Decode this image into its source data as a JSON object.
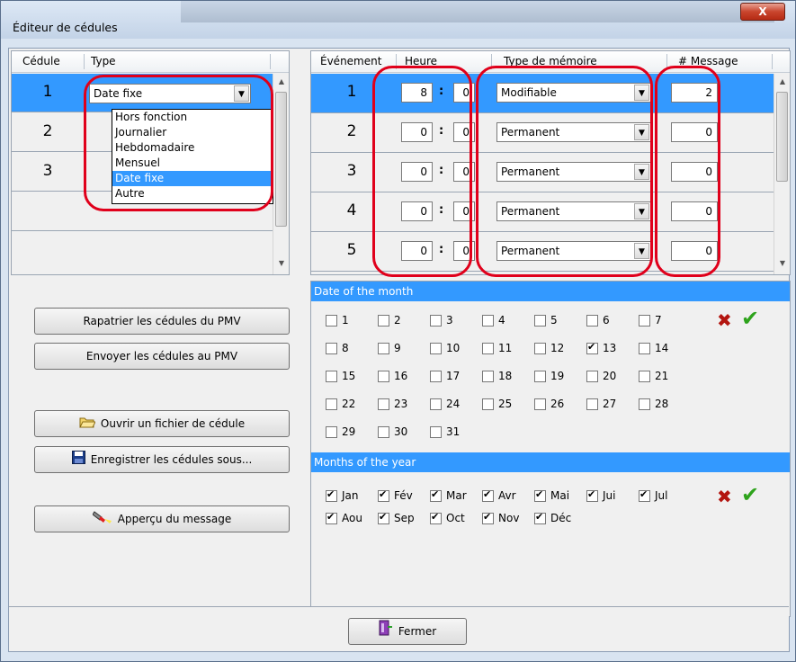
{
  "window": {
    "title": "Éditeur de cédules",
    "close": "X"
  },
  "left_grid": {
    "headers": [
      "Cédule",
      "Type"
    ],
    "rows": [
      {
        "num": "1",
        "type": "Date fixe"
      },
      {
        "num": "2",
        "type": ""
      },
      {
        "num": "3",
        "type": ""
      }
    ],
    "dropdown_options": [
      "Hors fonction",
      "Journalier",
      "Hebdomadaire",
      "Mensuel",
      "Date fixe",
      "Autre"
    ],
    "dropdown_selected": "Date fixe"
  },
  "right_grid": {
    "headers": [
      "Événement",
      "Heure",
      "Type de mémoire",
      "# Message"
    ],
    "rows": [
      {
        "num": "1",
        "hour": "8",
        "minute": "0",
        "memory": "Modifiable",
        "message": "2"
      },
      {
        "num": "2",
        "hour": "0",
        "minute": "0",
        "memory": "Permanent",
        "message": "0"
      },
      {
        "num": "3",
        "hour": "0",
        "minute": "0",
        "memory": "Permanent",
        "message": "0"
      },
      {
        "num": "4",
        "hour": "0",
        "minute": "0",
        "memory": "Permanent",
        "message": "0"
      },
      {
        "num": "5",
        "hour": "0",
        "minute": "0",
        "memory": "Permanent",
        "message": "0"
      }
    ],
    "colon": ":"
  },
  "buttons": {
    "rapatrier": "Rapatrier les cédules du PMV",
    "envoyer": "Envoyer les cédules au PMV",
    "ouvrir": "Ouvrir un fichier de cédule",
    "enregistrer": "Enregistrer les cédules sous...",
    "apercu": "Apperçu du message",
    "fermer": "Fermer"
  },
  "date_panel": {
    "title": "Date of the month",
    "days": [
      "1",
      "2",
      "3",
      "4",
      "5",
      "6",
      "7",
      "8",
      "9",
      "10",
      "11",
      "12",
      "13",
      "14",
      "15",
      "16",
      "17",
      "18",
      "19",
      "20",
      "21",
      "22",
      "23",
      "24",
      "25",
      "26",
      "27",
      "28",
      "29",
      "30",
      "31"
    ],
    "checked_days": [
      "13"
    ]
  },
  "months_panel": {
    "title": "Months of the year",
    "months": [
      "Jan",
      "Fév",
      "Mar",
      "Avr",
      "Mai",
      "Jui",
      "Jul",
      "Aou",
      "Sep",
      "Oct",
      "Nov",
      "Déc"
    ],
    "checked_months": [
      "Jan",
      "Fév",
      "Mar",
      "Avr",
      "Mai",
      "Jui",
      "Jul",
      "Aou",
      "Sep",
      "Oct",
      "Nov",
      "Déc"
    ]
  },
  "icons": {
    "clear": "red-x-icon",
    "select_all": "green-check-icon",
    "accent": "#3399ff",
    "highlight_red": "#e0001b"
  }
}
